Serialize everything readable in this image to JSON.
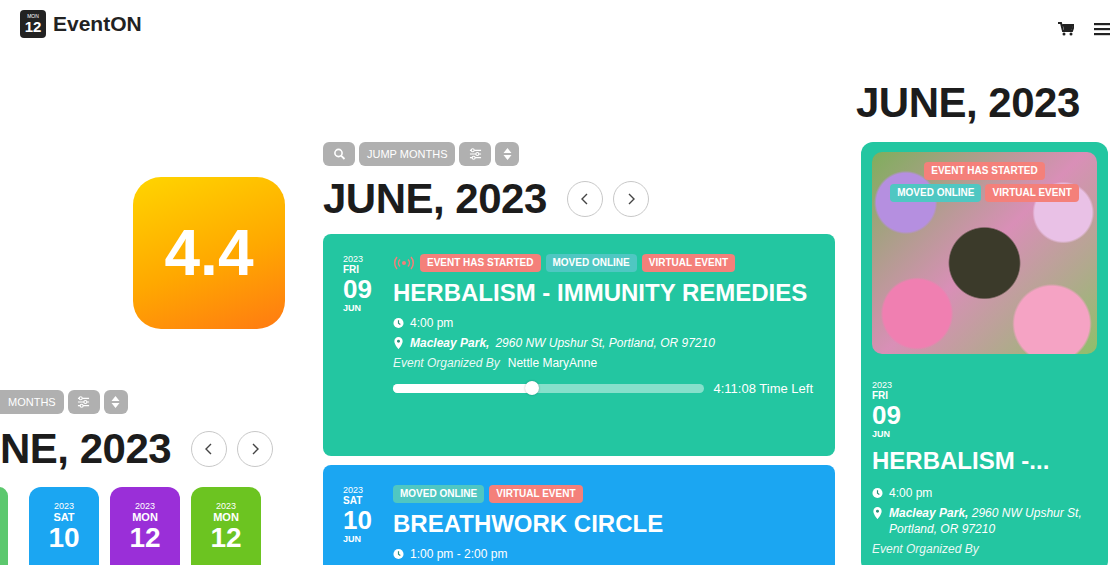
{
  "header": {
    "logo": {
      "weekday": "MON",
      "day": "12"
    },
    "brand": "EventON"
  },
  "rating": "4.4",
  "left_widget": {
    "toolbar": {
      "jump": "MONTHS"
    },
    "heading": "NE, 2023",
    "tiles": [
      {
        "kind": "edge",
        "color": "#5cc86e"
      },
      {
        "kind": "full",
        "year": "2023",
        "weekday": "SAT",
        "day": "10",
        "color": "#1ba6f2"
      },
      {
        "kind": "full",
        "year": "2023",
        "weekday": "MON",
        "day": "12",
        "color": "#9a2fd8"
      },
      {
        "kind": "full",
        "year": "2023",
        "weekday": "MON",
        "day": "12",
        "color": "#6cc421"
      }
    ]
  },
  "middle_widget": {
    "toolbar": {
      "jump": "JUMP MONTHS"
    },
    "heading": "JUNE, 2023",
    "events": [
      {
        "year": "2023",
        "weekday": "FRI",
        "day": "09",
        "month": "JUN",
        "live": true,
        "badges": [
          {
            "label": "EVENT HAS STARTED",
            "color": "#f4807a"
          },
          {
            "label": "MOVED ONLINE",
            "color": "#4fc7c2"
          },
          {
            "label": "VIRTUAL EVENT",
            "color": "#f4807a"
          }
        ],
        "title": "HERBALISM - IMMUNITY REMEDIES",
        "time": "4:00 pm",
        "venue": "Macleay Park,",
        "address": "2960 NW Upshur St, Portland, OR 97210",
        "organizer_label": "Event Organized By",
        "organizer": "Nettle MaryAnne",
        "progress": {
          "level": 0.45,
          "reading": "4:11:08 Time Left"
        },
        "color": "#23c6a1"
      },
      {
        "year": "2023",
        "weekday": "SAT",
        "day": "10",
        "month": "JUN",
        "live": false,
        "badges": [
          {
            "label": "MOVED ONLINE",
            "color": "#4fc7c2"
          },
          {
            "label": "VIRTUAL EVENT",
            "color": "#f4807a"
          }
        ],
        "title": "BREATHWORK CIRCLE",
        "time": "1:00 pm - 2:00 pm",
        "color": "#1ba6f2"
      }
    ]
  },
  "right_widget": {
    "heading": "JUNE, 2023",
    "event": {
      "year": "2023",
      "weekday": "FRI",
      "day": "09",
      "month": "JUN",
      "badges": [
        {
          "label": "EVENT HAS STARTED",
          "color": "#f4807a"
        },
        {
          "label": "MOVED ONLINE",
          "color": "#4fc7c2"
        },
        {
          "label": "VIRTUAL EVENT",
          "color": "#f4807a"
        }
      ],
      "title": "HERBALISM -...",
      "time": "4:00 pm",
      "venue": "Macleay Park,",
      "address": "2960 NW Upshur St, Portland, OR 97210",
      "organizer_label": "Event Organized By",
      "color": "#23c6a1"
    }
  }
}
